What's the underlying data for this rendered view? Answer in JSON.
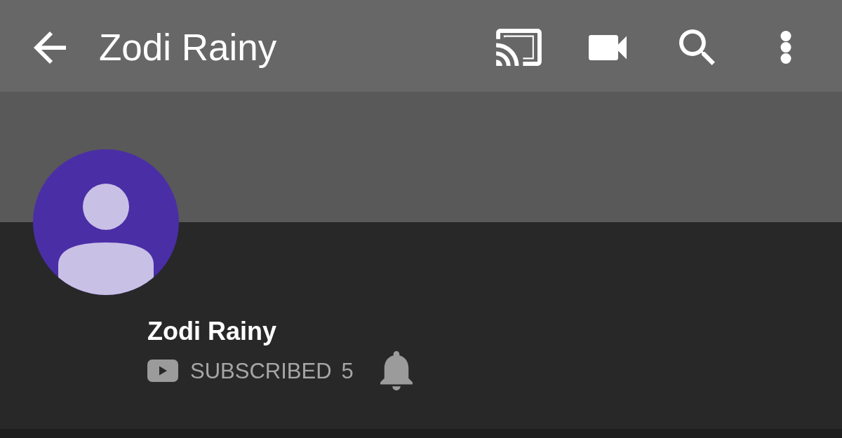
{
  "app_bar": {
    "title": "Zodi Rainy"
  },
  "channel": {
    "name": "Zodi Rainy",
    "subscription": {
      "label": "SUBSCRIBED",
      "subscribed": true,
      "count": "5"
    }
  }
}
